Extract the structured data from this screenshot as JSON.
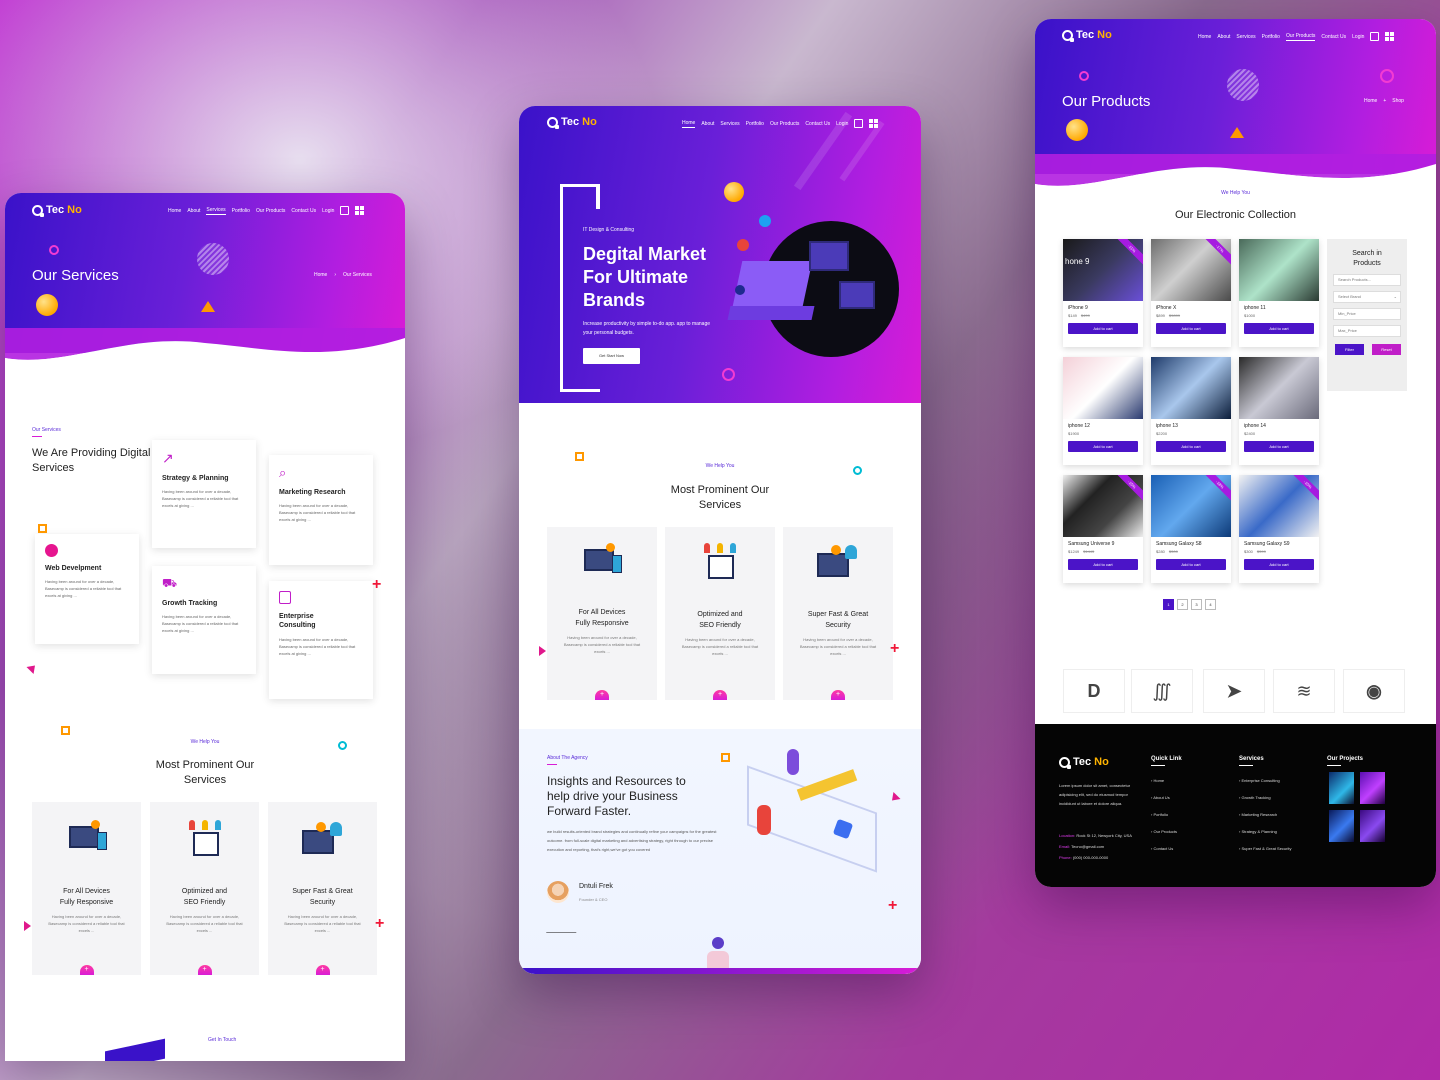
{
  "brand": {
    "logo_left": "TecNo",
    "logo_tec": "Tec",
    "logo_no": "No"
  },
  "mockup_left": {
    "nav": [
      "Home",
      "About",
      "Services",
      "Portfolio",
      "Our Products",
      "Contact Us",
      "Login"
    ],
    "active_nav": "Services",
    "hero_title": "Our Services",
    "breadcrumb": {
      "home": "Home",
      "sep": "›",
      "current": "Our Services"
    },
    "intro": {
      "kicker": "Our Services",
      "heading": "We Are Providing Digital Services"
    },
    "cards": [
      {
        "title": "Strategy & Planning",
        "text": "Having been around for over a decade, Basecamp is considered a reliable tool that excels at giving ..."
      },
      {
        "title": "Marketing Research",
        "text": "Having been around for over a decade, Basecamp is considered a reliable tool that excels at giving ..."
      },
      {
        "title": "Web Develpment",
        "text": "Having been around for over a decade, Basecamp is considered a reliable tool that excels at giving ..."
      },
      {
        "title": "Growth Tracking",
        "text": "Having been around for over a decade, Basecamp is considered a reliable tool that excels at giving ..."
      },
      {
        "title": "Enterprise Consulting",
        "text": "Having been around for over a decade, Basecamp is considered a reliable tool that excels at giving ..."
      }
    ],
    "help_kicker": "We Help You",
    "help_heading": "Most Prominent Our Services",
    "services": [
      {
        "l1": "For All Devices",
        "l2": "Fully Responsive",
        "text": "Having been around for over a decade, Basecamp is considered a reliable tool that excels ..."
      },
      {
        "l1": "Optimized and",
        "l2": "SEO Friendly",
        "text": "Having been around for over a decade, Basecamp is considered a reliable tool that excels ..."
      },
      {
        "l1": "Super Fast & Great",
        "l2": "Security",
        "text": "Having been around for over a decade, Basecamp is considered a reliable tool that excels ..."
      }
    ],
    "touch_kicker": "Get In Touch"
  },
  "mockup_center": {
    "nav": [
      "Home",
      "About",
      "Services",
      "Portfolio",
      "Our Products",
      "Contact Us",
      "Login"
    ],
    "active_nav": "Home",
    "hero": {
      "kicker": "IT Design & Consulting",
      "title_l1": "Degital Market",
      "title_l2": "For Ultimate",
      "title_l3": "Brands",
      "text": "Increase productivity by simple to-do app. app to manage your personal budgets.",
      "cta": "Get Start Now"
    },
    "help_kicker": "We Help You",
    "help_heading_l1": "Most Prominent Our",
    "help_heading_l2": "Services",
    "services": [
      {
        "l1": "For All Devices",
        "l2": "Fully Responsive",
        "text": "Having been around for over a decade, Basecamp is considered a reliable tool that excels ..."
      },
      {
        "l1": "Optimized and",
        "l2": "SEO Friendly",
        "text": "Having been around for over a decade, Basecamp is considered a reliable tool that excels ..."
      },
      {
        "l1": "Super Fast & Great",
        "l2": "Security",
        "text": "Having been around for over a decade, Basecamp is considered a reliable tool that excels ..."
      }
    ],
    "about": {
      "kicker": "About The Agency",
      "heading_l1": "Insights and Resources to",
      "heading_l2": "help drive your Business",
      "heading_l3": "Forward Faster.",
      "text": "we build results-oriented brand strategies and continually refine your campaigns for the greatest outcome. from full-scale digital marketing and advertising strategy, right through to our precise execution and reporting, that's right,we've got you covered",
      "author": "Dntuli Frek",
      "role": "Founder & CEO"
    }
  },
  "mockup_right": {
    "nav": [
      "Home",
      "About",
      "Services",
      "Portfolio",
      "Our Products",
      "Contact Us",
      "Login"
    ],
    "active_nav": "Our Products",
    "hero_title": "Our Products",
    "breadcrumb": {
      "home": "Home",
      "sep": "+",
      "current": "Shop"
    },
    "kicker": "We Help You",
    "heading": "Our Electronic Collection",
    "add_label": "Add to cart",
    "products": [
      {
        "name": "iPhone 9",
        "price": "$149",
        "old": "$499",
        "ribbon": "-11%",
        "img": "hone 9"
      },
      {
        "name": "iPhone X",
        "price": "$899",
        "old": "$9899",
        "ribbon": "-17%",
        "img": ""
      },
      {
        "name": "iphone 11",
        "price": "$1000",
        "old": "",
        "ribbon": "",
        "img": ""
      },
      {
        "name": "iphone 12",
        "price": "$1900",
        "old": "",
        "ribbon": "",
        "img": ""
      },
      {
        "name": "iphone 13",
        "price": "$2200",
        "old": "",
        "ribbon": "",
        "img": ""
      },
      {
        "name": "iphone 14",
        "price": "$2400",
        "old": "",
        "ribbon": "",
        "img": ""
      },
      {
        "name": "Samsung Universe 9",
        "price": "$1249",
        "old": "$1443",
        "ribbon": "-15%",
        "img": ""
      },
      {
        "name": "Samsung Galaxy S8",
        "price": "$280",
        "old": "$300",
        "ribbon": "-18%",
        "img": ""
      },
      {
        "name": "Samsung Galaxy S9",
        "price": "$300",
        "old": "$399",
        "ribbon": "-10%",
        "img": ""
      }
    ],
    "sidebar": {
      "title_l1": "Search in",
      "title_l2": "Products",
      "search_ph": "Search Products...",
      "brand_ph": "Select Brand",
      "min_ph": "Min_Price",
      "max_ph": "Max_Price",
      "filter": "Filter",
      "reset": "Reset"
    },
    "pages": [
      "1",
      "2",
      "3",
      "4"
    ],
    "footer": {
      "about": "Lorem ipsum dolor sit amet, consectetur adipisicing elit, sed do eiusmod tempor incididunt ut labore et dolore aliqua.",
      "location_label": "Location:",
      "location": "Rock St 12, Newyork City, USA",
      "email_label": "Email:",
      "email": "Tecno@gmail.com",
      "phone_label": "Phone:",
      "phone": "(000) 000-000-0000",
      "quick_title": "Quick Link",
      "quick": [
        "Home",
        "About Us",
        "Portfolio",
        "Our Products",
        "Contact Us"
      ],
      "services_title": "Services",
      "services": [
        "Enterprise Consulting",
        "Growth Tracking",
        "Marketing Research",
        "Strategy & Planning",
        "Super Fast & Great Security"
      ],
      "projects_title": "Our Projects"
    }
  },
  "colors": {
    "primary": "#3a12c9",
    "accent": "#d81cd6",
    "button": "#4b14c8",
    "orange": "#ffa900",
    "footer_bg": "#050505"
  }
}
